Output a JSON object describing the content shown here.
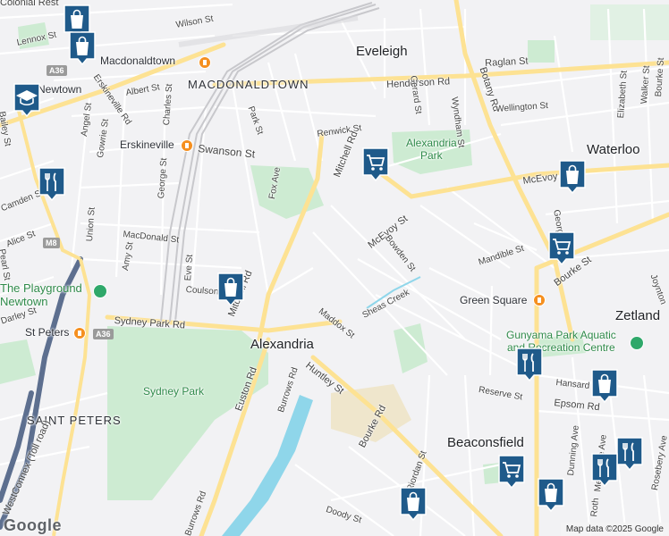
{
  "map": {
    "suburbs": {
      "eveleigh": "Eveleigh",
      "macdonaldtown_area": "MACDONALDTOWN",
      "waterloo": "Waterloo",
      "alexandria": "Alexandria",
      "zetland": "Zetland",
      "beaconsfield": "Beaconsfield",
      "saint_peters": "SAINT PETERS",
      "st_peters": "St Peters",
      "newtown": "Newtown",
      "macdonaldtown_station": "Macdonaldtown",
      "erskineville": "Erskineville",
      "green_square": "Green Square"
    },
    "parks": {
      "alexandria_park": "Alexandria\nPark",
      "sydney_park": "Sydney Park",
      "playground": "The Playground\nNewtown",
      "gunyama": "Gunyama Park Aquatic\nand Recreation Centre"
    },
    "water": {
      "sheas_creek": "Sheas Creek"
    },
    "streets": {
      "wilson": "Wilson St",
      "lennox": "Lennox St",
      "albert": "Albert St",
      "erskineville_rd": "Erskineville Rd",
      "angel": "Angel St",
      "gowrie": "Gowrie St",
      "charles": "Charles St",
      "george": "George St",
      "park": "Park St",
      "swanson": "Swanson St",
      "fox": "Fox Ave",
      "henderson": "Henderson Rd",
      "raglan": "Raglan St",
      "renwick": "Renwick St",
      "mitchell_n": "Mitchell Rd",
      "gerard": "Gerard St",
      "wyndham": "Wyndham St",
      "botany": "Botany Rd",
      "wellington": "Wellington St",
      "elizabeth": "Elizabeth St",
      "walker": "Walker St",
      "bourke_ne": "Bourke St",
      "mcevoy_e": "McEvoy St",
      "mcevoy": "McEvoy St",
      "bowden": "Bowden St",
      "mandible": "Mandible St",
      "bourke_e": "Bourke St",
      "george_e": "George St",
      "joynton": "Joynton",
      "union": "Union St",
      "amy": "Amy St",
      "macdonald": "MacDonald St",
      "eve": "Eve St",
      "coulson": "Coulson St",
      "mitchell_s": "Mitchell Rd",
      "alice": "Alice St",
      "camden": "Camden St",
      "bailey": "Bailey St",
      "pearl": "Pearl St",
      "darley": "Darley St",
      "sydney_park_rd": "Sydney Park Rd",
      "maddox": "Maddox St",
      "huntley": "Huntley St",
      "euston": "Euston Rd",
      "burrows": "Burrows Rd",
      "burrows_s": "Burrows Rd",
      "bourke_s": "Bourke Rd",
      "riordan": "Riordan St",
      "doody": "Doody St",
      "reserve": "Reserve St",
      "epsom": "Epsom Rd",
      "hansard": "Hansard",
      "dunning": "Dunning Ave",
      "mentmore": "Mentmore Ave",
      "rothschild": "Roth",
      "rosebery": "Rosebery Ave",
      "westconnex": "WestConnex (Toll road)",
      "colonial": "Colonial Rest"
    },
    "route_badges": [
      "A36",
      "M8",
      "A36"
    ],
    "pins": [
      {
        "name": "shopping-bag-icon",
        "label": "Shop"
      },
      {
        "name": "shopping-bag-icon",
        "label": "Shop"
      },
      {
        "name": "graduation-cap-icon",
        "label": "School"
      },
      {
        "name": "restaurant-icon",
        "label": "Restaurant"
      },
      {
        "name": "shopping-bag-icon",
        "label": "Shop"
      },
      {
        "name": "shopping-cart-icon",
        "label": "Supermarket"
      },
      {
        "name": "shopping-bag-icon",
        "label": "Shop"
      },
      {
        "name": "shopping-cart-icon",
        "label": "Supermarket"
      },
      {
        "name": "restaurant-icon",
        "label": "Restaurant"
      },
      {
        "name": "shopping-bag-icon",
        "label": "Shop"
      },
      {
        "name": "restaurant-icon",
        "label": "Restaurant"
      },
      {
        "name": "shopping-cart-icon",
        "label": "Supermarket"
      },
      {
        "name": "shopping-bag-icon",
        "label": "Shop"
      },
      {
        "name": "restaurant-icon",
        "label": "Restaurant"
      },
      {
        "name": "shopping-bag-icon",
        "label": "Shop"
      }
    ],
    "colors": {
      "background": "#f2f2f4",
      "park": "#cdebd2",
      "water": "#8fd6ea",
      "arterial": "#fde293",
      "motorway": "#5d6f8f",
      "pin": "#1f5a8a",
      "station": "#f58f1f"
    }
  },
  "footer": {
    "logo": "Google",
    "attribution": "Map data ©2025 Google"
  }
}
